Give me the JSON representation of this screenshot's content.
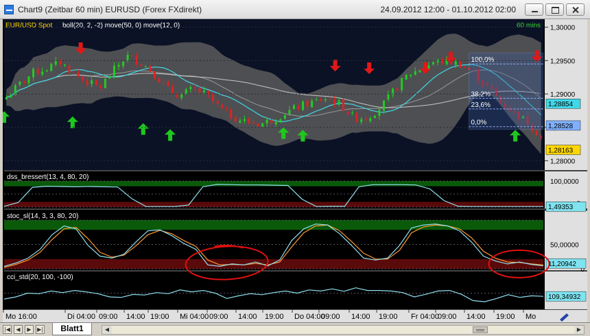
{
  "window": {
    "title": "Chart9 (Zeitbar 60 min)  EURUSD (Forex FXdirekt)",
    "date_range": "24.09.2012 12:00 - 01.10.2012 02:00"
  },
  "tabs": {
    "sheet": "Blatt1"
  },
  "colors": {
    "background": "#000000",
    "price_panel_bg": "#0b1226",
    "axis_bg": "#e0e0e0",
    "candle_up": "#22cc22",
    "candle_down": "#dd2222",
    "band_fill": "#5a5a5a",
    "sma50": "#c8c8c8",
    "sma12": "#40d8e8",
    "buy_arrow": "#1ec81e",
    "sell_arrow": "#e01818",
    "overbought": "#0a5a0a",
    "oversold": "#5a0a0a",
    "indicator_line": "#8fe0f0",
    "signal_line": "#ff9933",
    "annotation": "#e01010",
    "highlight": "#dde6ff"
  },
  "chart_data": [
    {
      "type": "candlestick",
      "label": "EUR/USD Spot",
      "overlays": "boll(20, 2, -2) move(50, 0) move(12, 0)",
      "timeframe": "60 mins",
      "x_tick_labels": [
        "Mo 16:00",
        "Di 04:00",
        "09:00",
        "14:00",
        "19:00",
        "Mi 04:00",
        "09:00",
        "14:00",
        "19:00",
        "Do 04:00",
        "09:00",
        "14:00",
        "19:00",
        "Fr 04:00",
        "09:00",
        "14:00",
        "19:00",
        "Mo"
      ],
      "y_tick_labels": [
        "1,30000",
        "1,29500",
        "1,29000",
        "1,28500",
        "1,28000"
      ],
      "ylim": [
        1.2786,
        1.3012
      ],
      "price_labels": [
        "1,28854",
        "1,28528",
        "1,28163"
      ],
      "fibonacci_labels": [
        "100,0%",
        "38,2%",
        "23,6%",
        "0,0%"
      ],
      "fibonacci_levels": [
        1.2945,
        1.28935,
        1.28775,
        1.2851
      ],
      "close_path": [
        1.2895,
        1.2915,
        1.2932,
        1.2938,
        1.2948,
        1.2932,
        1.2918,
        1.291,
        1.2935,
        1.2957,
        1.2948,
        1.2932,
        1.2908,
        1.2897,
        1.2908,
        1.2898,
        1.2878,
        1.2865,
        1.2858,
        1.2855,
        1.2862,
        1.2873,
        1.2882,
        1.2888,
        1.2894,
        1.2884,
        1.2864,
        1.2865,
        1.288,
        1.2905,
        1.2928,
        1.2938,
        1.2948,
        1.295,
        1.2944,
        1.2931,
        1.291,
        1.2888,
        1.2872,
        1.2858,
        1.2835
      ],
      "buy_signals": [
        [
          0.0,
          1.2866
        ],
        [
          0.127,
          1.2858
        ],
        [
          0.258,
          1.2848
        ],
        [
          0.308,
          1.2839
        ],
        [
          0.518,
          1.2842
        ],
        [
          0.554,
          1.2838
        ],
        [
          0.948,
          1.2838
        ]
      ],
      "sell_signals": [
        [
          0.142,
          1.2968
        ],
        [
          0.614,
          1.2942
        ],
        [
          0.677,
          1.2938
        ],
        [
          0.781,
          1.2938
        ],
        [
          0.828,
          1.2954
        ],
        [
          0.988,
          1.2956
        ]
      ]
    },
    {
      "type": "line",
      "label": "dss_bressert(13, 4, 80, 20)",
      "y_tick_labels": [
        "100,0000",
        "0"
      ],
      "value_label": "1,49353",
      "ylim": [
        0,
        100
      ],
      "zones": [
        20,
        80
      ],
      "values": [
        3,
        18,
        76,
        80,
        79,
        78,
        79,
        78,
        77,
        32,
        2,
        2,
        2,
        8,
        78,
        87,
        86,
        85,
        85,
        84,
        83,
        30,
        2,
        3,
        3,
        78,
        86,
        86,
        86,
        85,
        70,
        25,
        3,
        2,
        2,
        2,
        2,
        2,
        2
      ]
    },
    {
      "type": "line",
      "label": "stoc_sl(14, 3, 3, 80, 20)",
      "y_tick_labels": [
        "50,00000",
        "0"
      ],
      "value_label": "11,20942",
      "ylim": [
        0,
        100
      ],
      "zones": [
        20,
        80
      ],
      "series": [
        {
          "values": [
            5,
            12,
            22,
            40,
            70,
            88,
            82,
            48,
            26,
            22,
            30,
            55,
            78,
            80,
            68,
            52,
            40,
            8,
            5,
            10,
            8,
            14,
            6,
            18,
            58,
            82,
            92,
            90,
            72,
            48,
            22,
            18,
            22,
            48,
            84,
            90,
            92,
            88,
            78,
            55,
            26,
            16,
            10,
            14,
            9,
            6
          ]
        },
        {
          "values": [
            3,
            9,
            18,
            34,
            60,
            82,
            85,
            62,
            34,
            24,
            28,
            47,
            70,
            79,
            72,
            58,
            46,
            18,
            8,
            9,
            8,
            11,
            8,
            14,
            45,
            74,
            88,
            90,
            78,
            56,
            32,
            20,
            20,
            38,
            74,
            86,
            90,
            88,
            82,
            64,
            36,
            22,
            14,
            13,
            10,
            8
          ]
        }
      ],
      "annotations": [
        "ellipse",
        "ellipse"
      ]
    },
    {
      "type": "line",
      "label": "cci_std(20, 100, -100)",
      "value_label": "109,34932",
      "values": [
        28,
        36,
        50,
        48,
        58,
        52,
        60,
        55,
        48,
        36,
        34,
        45,
        43,
        52,
        48,
        62,
        55,
        60,
        50,
        30,
        40,
        48,
        44,
        52,
        58,
        50,
        62,
        58,
        66,
        57,
        70,
        60,
        60,
        58,
        52,
        36,
        46,
        58,
        60,
        46,
        22,
        18,
        30,
        44,
        34,
        40,
        38
      ]
    }
  ]
}
